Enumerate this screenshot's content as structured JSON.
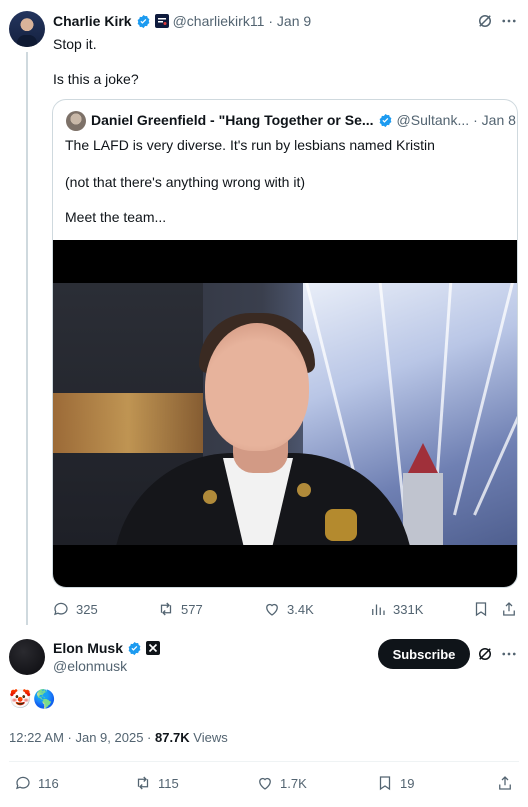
{
  "parent_tweet": {
    "author_name": "Charlie Kirk",
    "author_handle": "@charliekirk11",
    "date": "· Jan 9",
    "text_line1": "Stop it.",
    "text_line2": "Is this a joke?",
    "quote": {
      "author_name": "Daniel Greenfield - \"Hang Together or Se...",
      "author_handle": "@Sultank...",
      "date": "· Jan 8",
      "text_line1": "The LAFD is very diverse. It's run by lesbians named Kristin",
      "text_line2": "(not that there's anything wrong with it)",
      "text_line3": "Meet the team..."
    },
    "stats": {
      "replies": "325",
      "reposts": "577",
      "likes": "3.4K",
      "views": "331K"
    }
  },
  "reply_tweet": {
    "author_name": "Elon Musk",
    "author_handle": "@elonmusk",
    "subscribe_label": "Subscribe",
    "emoji_text": "🤡🌎",
    "time": "12:22 AM · Jan 9, 2025 · ",
    "views_count": "87.7K",
    "views_label": " Views",
    "stats": {
      "replies": "116",
      "reposts": "115",
      "likes": "1.7K",
      "bookmarks": "19"
    }
  },
  "icons": {
    "verified": "verified-badge-icon",
    "grok": "grok-icon",
    "more": "more-icon",
    "reply": "reply-icon",
    "repost": "repost-icon",
    "like": "like-icon",
    "views": "views-icon",
    "bookmark": "bookmark-icon",
    "share": "share-icon"
  },
  "colors": {
    "verified_blue": "#1d9bf0",
    "text": "#0f1419",
    "secondary": "#536471"
  }
}
